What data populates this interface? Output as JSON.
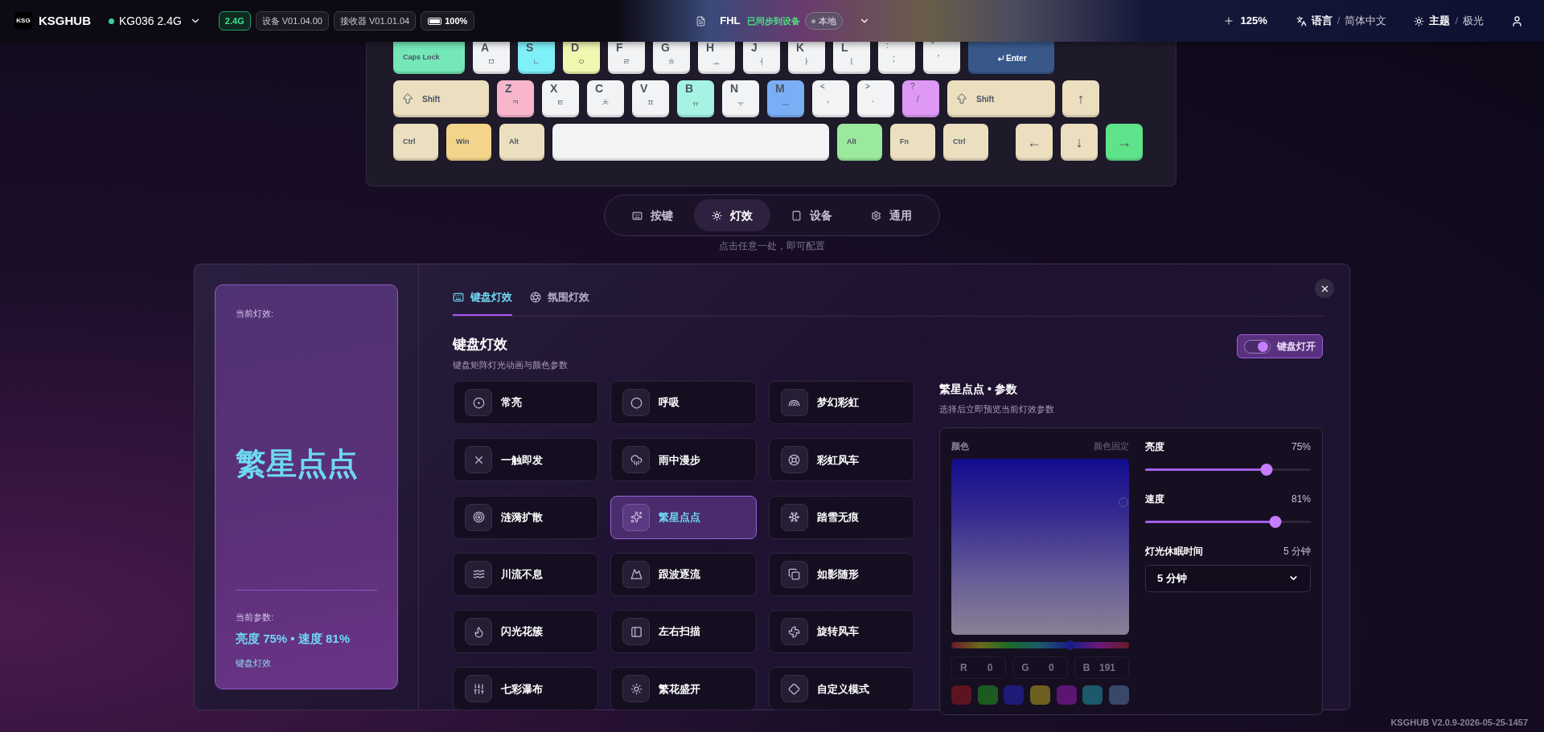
{
  "header": {
    "logo_text": "KSG",
    "app_name": "KSGHUB",
    "device": {
      "name": "KG036 2.4G",
      "connected": true
    },
    "badges": [
      {
        "kind": "mode",
        "text": "2.4G"
      },
      {
        "kind": "version",
        "text": "设备 V01.04.00"
      },
      {
        "kind": "version",
        "text": "接收器 V01.01.04"
      },
      {
        "kind": "battery",
        "text": "100%"
      }
    ],
    "profile": {
      "name": "FHL",
      "sync_status": "已同步到设备",
      "location": "本地"
    },
    "zoom": "125%",
    "language": {
      "label": "语言",
      "separator": "/",
      "value": "简体中文"
    },
    "theme": {
      "label": "主题",
      "separator": "/",
      "value": "极光"
    }
  },
  "keyboard": {
    "rows": [
      [
        {
          "kind": "text",
          "label": "Caps Lock",
          "color": "#74e8b8"
        },
        {
          "kind": "char",
          "label": "A",
          "sub": "ㅁ",
          "color": "#f1f3f4"
        },
        {
          "kind": "char",
          "label": "S",
          "sub": "ㄴ",
          "color": "#7ff0f8"
        },
        {
          "kind": "char",
          "label": "D",
          "sub": "ㅇ",
          "color": "#f2f7b0"
        },
        {
          "kind": "char",
          "label": "F",
          "sub": "ㄹ",
          "color": "#f1f3f4"
        },
        {
          "kind": "char",
          "label": "G",
          "sub": "ㅎ",
          "color": "#f1f3f4"
        },
        {
          "kind": "char",
          "label": "H",
          "sub": "ㅗ",
          "color": "#f1f3f4"
        },
        {
          "kind": "char",
          "label": "J",
          "sub": "ㅓ",
          "color": "#f1f3f4"
        },
        {
          "kind": "char",
          "label": "K",
          "sub": "ㅏ",
          "color": "#f1f3f4"
        },
        {
          "kind": "char",
          "label": "L",
          "sub": "ㅣ",
          "color": "#f1f3f4"
        },
        {
          "kind": "symbol",
          "label": ":",
          "sub": ";",
          "color": "#f1f3f4"
        },
        {
          "kind": "symbol",
          "label": "\"",
          "sub": "'",
          "color": "#f1f3f4"
        },
        {
          "kind": "enter",
          "label": "Enter",
          "color": "#38588a"
        }
      ],
      [
        {
          "kind": "shift",
          "label": "Shift",
          "color": "#ebdfbf"
        },
        {
          "kind": "char",
          "label": "Z",
          "sub": "ㅋ",
          "color": "#f7b6cc"
        },
        {
          "kind": "char",
          "label": "X",
          "sub": "ㅌ",
          "color": "#f1f3f4"
        },
        {
          "kind": "char",
          "label": "C",
          "sub": "ㅊ",
          "color": "#f1f3f4"
        },
        {
          "kind": "char",
          "label": "V",
          "sub": "ㅍ",
          "color": "#f1f3f4"
        },
        {
          "kind": "char",
          "label": "B",
          "sub": "ㅠ",
          "color": "#a6f3e4"
        },
        {
          "kind": "char",
          "label": "N",
          "sub": "ㅜ",
          "color": "#f1f3f4"
        },
        {
          "kind": "char",
          "label": "M",
          "sub": "ㅡ",
          "color": "#7aaef5"
        },
        {
          "kind": "symbol",
          "label": "<",
          "sub": ",",
          "color": "#f1f3f4"
        },
        {
          "kind": "symbol",
          "label": ">",
          "sub": ".",
          "color": "#f1f3f4"
        },
        {
          "kind": "symbol",
          "label": "?",
          "sub": "/",
          "color": "#dd99f5"
        },
        {
          "kind": "shift",
          "label": "Shift",
          "color": "#ebdfbf"
        },
        {
          "kind": "glyph",
          "label": "↑",
          "color": "#ebdfbf"
        }
      ],
      [
        {
          "kind": "text",
          "label": "Ctrl",
          "color": "#ebdfbf"
        },
        {
          "kind": "text",
          "label": "Win",
          "color": "#f3d48a"
        },
        {
          "kind": "text",
          "label": "Alt",
          "color": "#ebdfbf"
        },
        {
          "kind": "space",
          "color": "#f1f3f4"
        },
        {
          "kind": "text",
          "label": "Alt",
          "color": "#9be99d"
        },
        {
          "kind": "text",
          "label": "Fn",
          "color": "#ebdfbf"
        },
        {
          "kind": "text",
          "label": "Ctrl",
          "color": "#ebdfbf"
        },
        {
          "kind": "glyph",
          "label": "←",
          "color": "#ebdfbf"
        },
        {
          "kind": "glyph",
          "label": "↓",
          "color": "#ebdfbf"
        },
        {
          "kind": "glyph",
          "label": "→",
          "color": "#5fe38a"
        }
      ]
    ]
  },
  "nav_tabs": [
    {
      "kind": "keys",
      "label": "按键",
      "selected": false
    },
    {
      "kind": "lighting",
      "label": "灯效",
      "selected": true
    },
    {
      "kind": "device",
      "label": "设备",
      "selected": false
    },
    {
      "kind": "general",
      "label": "通用",
      "selected": false
    }
  ],
  "hint": "点击任意一处，即可配置",
  "lighting": {
    "current": {
      "label": "当前灯效:",
      "effect": "繁星点点",
      "params_label": "当前参数:",
      "params": "亮度 75% • 速度 81%",
      "category": "键盘灯效"
    },
    "tabs": [
      {
        "kind": "keyboard",
        "label": "键盘灯效",
        "selected": true
      },
      {
        "kind": "ambient",
        "label": "氛围灯效",
        "selected": false
      }
    ],
    "title": "键盘灯效",
    "subtitle": "键盘矩阵灯光动画与颜色参数",
    "toggle": {
      "label": "键盘灯开",
      "on": true
    },
    "effects": [
      {
        "kind": "static",
        "label": "常亮",
        "selected": false
      },
      {
        "kind": "breathing",
        "label": "呼吸",
        "selected": false
      },
      {
        "kind": "rainbow",
        "label": "梦幻彩虹",
        "selected": false
      },
      {
        "kind": "trigger",
        "label": "一触即发",
        "selected": false
      },
      {
        "kind": "rain",
        "label": "雨中漫步",
        "selected": false
      },
      {
        "kind": "wheel",
        "label": "彩虹风车",
        "selected": false
      },
      {
        "kind": "ripple",
        "label": "涟漪扩散",
        "selected": false
      },
      {
        "kind": "stars",
        "label": "繁星点点",
        "selected": true
      },
      {
        "kind": "snow",
        "label": "踏雪无痕",
        "selected": false
      },
      {
        "kind": "stream",
        "label": "川流不息",
        "selected": false
      },
      {
        "kind": "wave",
        "label": "跟波逐流",
        "selected": false
      },
      {
        "kind": "shadow",
        "label": "如影随形",
        "selected": false
      },
      {
        "kind": "flash",
        "label": "闪光花簇",
        "selected": false
      },
      {
        "kind": "scan",
        "label": "左右扫描",
        "selected": false
      },
      {
        "kind": "pinwheel",
        "label": "旋转风车",
        "selected": false
      },
      {
        "kind": "waterfall",
        "label": "七彩瀑布",
        "selected": false
      },
      {
        "kind": "bloom",
        "label": "繁花盛开",
        "selected": false
      },
      {
        "kind": "custom",
        "label": "自定义模式",
        "selected": false
      }
    ],
    "params": {
      "title": "繁星点点 • 参数",
      "subtitle": "选择后立即预览当前灯效参数",
      "color_label": "颜色",
      "color_note": "颜色固定",
      "hue": {
        "level": 0.67
      },
      "rgb": [
        {
          "label": "R",
          "value": "0"
        },
        {
          "label": "G",
          "value": "0"
        },
        {
          "label": "B",
          "value": "191"
        }
      ],
      "swatches": [
        {
          "color": "#5c1420"
        },
        {
          "color": "#1d5a22"
        },
        {
          "color": "#1e1a78"
        },
        {
          "color": "#6b6020"
        },
        {
          "color": "#5a1670"
        },
        {
          "color": "#1a5a6a"
        },
        {
          "color": "#3a4868"
        }
      ],
      "sliders": [
        {
          "label": "亮度",
          "reading": "75%",
          "level": 0.75
        },
        {
          "label": "速度",
          "reading": "81%",
          "level": 0.81
        }
      ],
      "sleep": {
        "label": "灯光休眠时间",
        "reading": "5 分钟",
        "value": "5 分钟"
      }
    }
  },
  "version": "KSGHUB V2.0.9-2026-05-25-1457"
}
